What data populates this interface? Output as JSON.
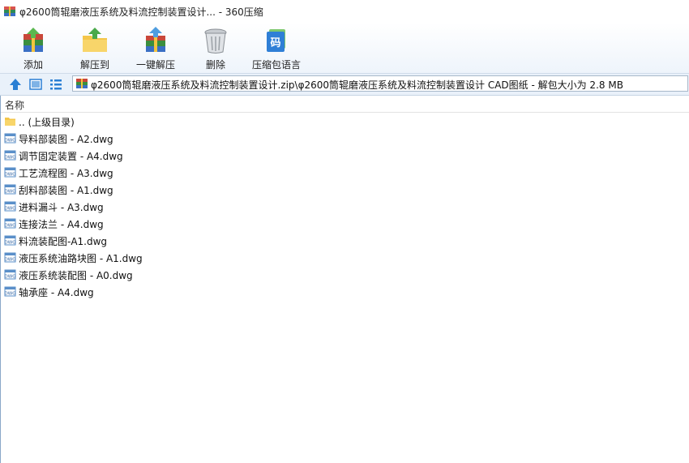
{
  "window": {
    "title": "φ2600筒辊磨液压系统及料流控制装置设计... - 360压缩"
  },
  "toolbar": {
    "buttons": [
      {
        "label": "添加",
        "icon": "add-archive-icon"
      },
      {
        "label": "解压到",
        "icon": "extract-to-icon"
      },
      {
        "label": "一键解压",
        "icon": "one-click-extract-icon"
      },
      {
        "label": "删除",
        "icon": "trash-icon"
      },
      {
        "label": "压缩包语言",
        "icon": "archive-language-icon"
      }
    ]
  },
  "nav": {
    "path": "φ2600筒辊磨液压系统及料流控制装置设计.zip\\φ2600筒辊磨液压系统及料流控制装置设计  CAD图纸 - 解包大小为 2.8 MB"
  },
  "filelist": {
    "column_name": "名称",
    "items": [
      {
        "name": ".. (上级目录)",
        "type": "folder"
      },
      {
        "name": "导料部装图 - A2.dwg",
        "type": "dwg"
      },
      {
        "name": "调节固定装置 - A4.dwg",
        "type": "dwg"
      },
      {
        "name": "工艺流程图 - A3.dwg",
        "type": "dwg"
      },
      {
        "name": "刮料部装图 - A1.dwg",
        "type": "dwg"
      },
      {
        "name": "进料漏斗 - A3.dwg",
        "type": "dwg"
      },
      {
        "name": "连接法兰 - A4.dwg",
        "type": "dwg"
      },
      {
        "name": "料流装配图-A1.dwg",
        "type": "dwg"
      },
      {
        "name": "液压系统油路块图 - A1.dwg",
        "type": "dwg"
      },
      {
        "name": "液压系统装配图 - A0.dwg",
        "type": "dwg"
      },
      {
        "name": "轴承座 - A4.dwg",
        "type": "dwg"
      }
    ]
  },
  "colors": {
    "accent": "#2a7fd4",
    "nav_bg": "#e9f1fa",
    "folder": "#f4c64a"
  }
}
